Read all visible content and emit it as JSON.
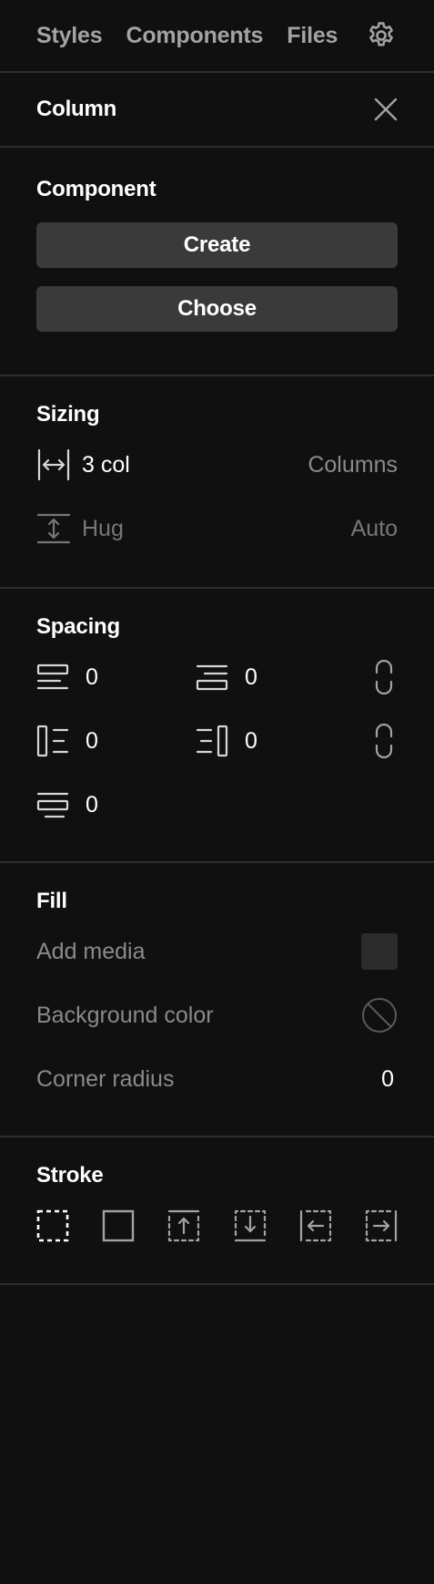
{
  "topnav": {
    "tabs": [
      "Styles",
      "Components",
      "Files"
    ],
    "settings_icon": "gear-icon"
  },
  "header": {
    "title": "Column",
    "close_icon": "close-icon"
  },
  "component": {
    "title": "Component",
    "create_label": "Create",
    "choose_label": "Choose"
  },
  "sizing": {
    "title": "Sizing",
    "width_value": "3 col",
    "width_mode": "Columns",
    "height_value": "Hug",
    "height_mode": "Auto"
  },
  "spacing": {
    "title": "Spacing",
    "margin_top": "0",
    "padding_top": "0",
    "margin_left": "0",
    "padding_right": "0",
    "margin_bottom": "0"
  },
  "fill": {
    "title": "Fill",
    "add_media_label": "Add media",
    "background_label": "Background color",
    "corner_radius_label": "Corner radius",
    "corner_radius_value": "0"
  },
  "stroke": {
    "title": "Stroke"
  },
  "colors": {
    "background": "#101010",
    "divider": "#2e2e2e",
    "button": "#3a3a3a",
    "muted_text": "#8a8a8a",
    "swatch": "#2c2c2c"
  }
}
